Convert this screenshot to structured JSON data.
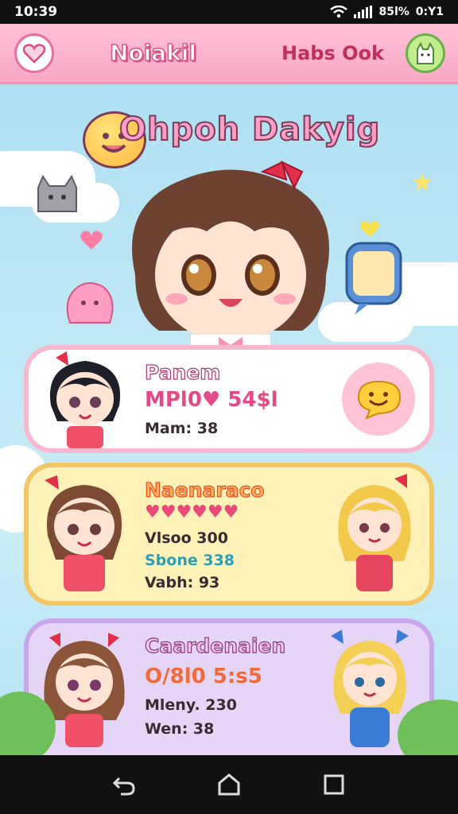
{
  "status_bar": {
    "time": "10:39",
    "battery": "85l%",
    "network": "0:Y1"
  },
  "app_bar": {
    "title": "Noiakil",
    "link_label": "Habs Ook",
    "heart_icon": "heart-icon",
    "avatar_icon": "cat-avatar-icon"
  },
  "hero": {
    "logo_text": "Ohpoh Dakyig"
  },
  "cards": [
    {
      "title": "Panem",
      "code": "MPl0♥ 54$l",
      "stat1": "Mam: 38",
      "badge_icon": "smiley-bubble-icon"
    },
    {
      "title": "Naenaraco",
      "code": "♥♥♥♥♥♥",
      "stat1": "Vlsoo 300",
      "stat2": "Sbone 338",
      "stat3": "Vabh: 93"
    },
    {
      "title": "Caardenaien",
      "code": "O/8l0 5:s5",
      "stat1": "Mleny. 230",
      "stat2": "Wen: 38"
    }
  ],
  "colors": {
    "pink": "#f9a8c6",
    "yellow": "#fff2b8",
    "lavender": "#e7d5f7",
    "sky": "#bfe7f5"
  }
}
